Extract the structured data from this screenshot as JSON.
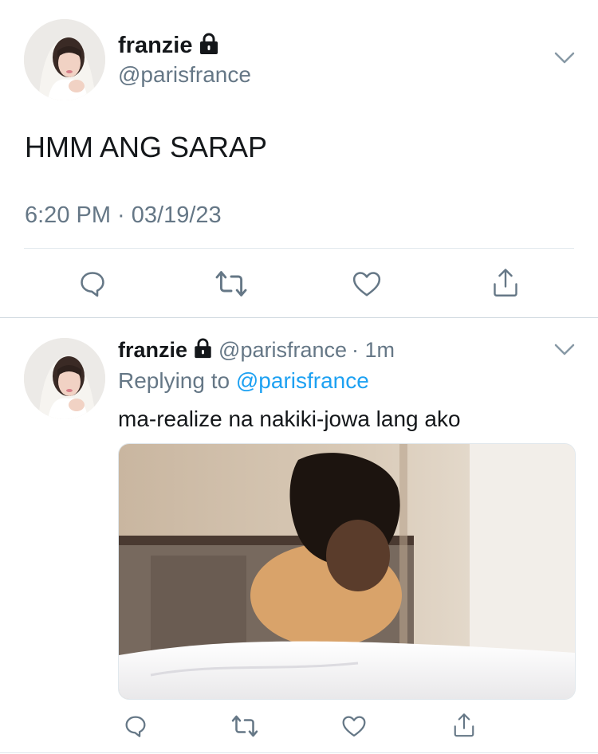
{
  "main_tweet": {
    "name": "franzie",
    "handle": "@parisfrance",
    "text": "HMM ANG SARAP",
    "timestamp": "6:20 PM · 03/19/23",
    "avatar_icon": "avatar-photo",
    "lock_icon": "lock-icon",
    "menu_icon": "chevron-down-icon"
  },
  "reply_tweet": {
    "name": "franzie",
    "handle": "@parisfrance",
    "time": "· 1m",
    "replying_prefix": "Replying to",
    "replying_handle": "@parisfrance",
    "text": "ma-realize na nakiki-jowa lang ako",
    "media_description_icon": "photo-media"
  },
  "actions": [
    "reply-icon",
    "retweet-icon",
    "like-icon",
    "share-icon"
  ],
  "colors": {
    "link": "#1da1f2",
    "secondary_text": "#657786",
    "divider": "#e1e8ed",
    "icon": "#657786"
  }
}
